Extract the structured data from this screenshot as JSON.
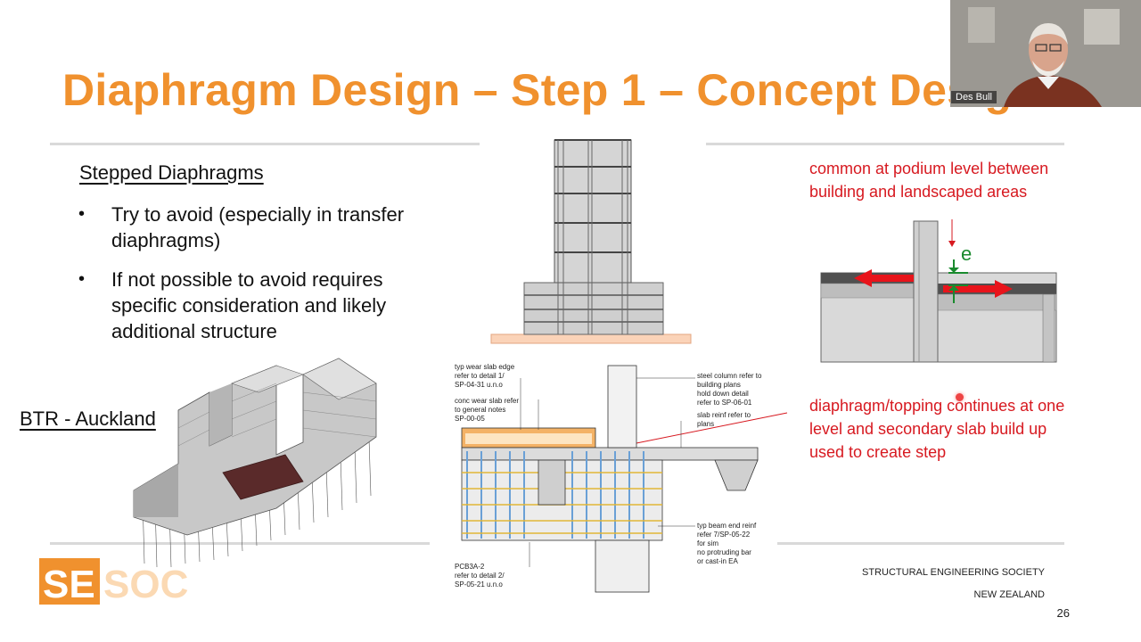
{
  "slide": {
    "title": "Diaphragm Design – Step 1 – Concept Design",
    "section_heading": "Stepped Diaphragms",
    "bullets": [
      "Try to avoid (especially in transfer diaphragms)",
      "If not possible to avoid requires specific consideration and likely additional structure"
    ],
    "project_label": "BTR - Auckland",
    "note_top": "common at podium level between building and landscaped areas",
    "note_bottom": "diaphragm/topping continues at one level and secondary slab build up used to create step",
    "diagram_symbol": "e",
    "footer_line1": "STRUCTURAL ENGINEERING SOCIETY",
    "footer_line2": "NEW ZEALAND",
    "page_number": "26",
    "logo_text": "SESOC"
  },
  "webcam": {
    "participant_name": "Des Bull"
  },
  "detail_labels": {
    "wear_slab_edge": [
      "typ wear slab edge",
      "refer to detail 1/",
      "SP-04-31 u.n.o"
    ],
    "conc_wear_slab": [
      "conc wear slab refer",
      "to general notes",
      "SP-00-05"
    ],
    "steel_column": [
      "steel column refer to",
      "building plans",
      "hold down detail",
      "refer to SP-06-01"
    ],
    "slab_reinf": [
      "slab reinf refer to",
      "plans"
    ],
    "beam_end_reinf": [
      "typ beam end reinf",
      "refer 7/SP-05-22",
      "for sim",
      "no protruding bar",
      "or cast-in EA"
    ],
    "pcb": [
      "PCB3A-2",
      "refer to detail 2/",
      "SP-05-21 u.n.o"
    ]
  },
  "colors": {
    "title_orange": "#f0912e",
    "note_red": "#d71920",
    "arrow_red": "#e8141b",
    "arrow_green": "#1a8a2e"
  }
}
